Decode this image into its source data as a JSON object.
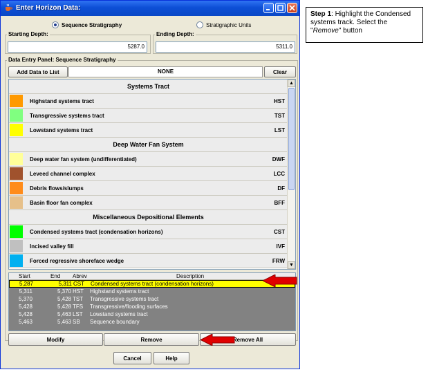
{
  "window": {
    "title": "Enter Horizon Data:"
  },
  "mode": {
    "options": [
      {
        "label": "Sequence Stratigraphy",
        "selected": true
      },
      {
        "label": "Stratigraphic Units",
        "selected": false
      }
    ]
  },
  "depth": {
    "starting_label": "Starting Depth:",
    "starting_value": "5287.0",
    "ending_label": "Ending Depth:",
    "ending_value": "5311.0"
  },
  "panel": {
    "title": "Data Entry Panel: Sequence Stratigraphy",
    "add_label": "Add Data to List",
    "current_value": "NONE",
    "clear_label": "Clear"
  },
  "categories": {
    "systems_tract": "Systems Tract",
    "deep_water": "Deep Water Fan System",
    "misc": "Miscellaneous Depositional Elements"
  },
  "items": [
    {
      "name": "Highstand systems tract",
      "abbr": "HST",
      "color": "#ff9900"
    },
    {
      "name": "Transgressive systems tract",
      "abbr": "TST",
      "color": "#80ff80"
    },
    {
      "name": "Lowstand systems tract",
      "abbr": "LST",
      "color": "#ffff00"
    },
    {
      "name": "Deep water fan system (undifferentiated)",
      "abbr": "DWF",
      "color": "#ffff99"
    },
    {
      "name": "Leveed channel complex",
      "abbr": "LCC",
      "color": "#a0522d"
    },
    {
      "name": "Debris flows/slumps",
      "abbr": "DF",
      "color": "#ff8c1a"
    },
    {
      "name": "Basin floor fan complex",
      "abbr": "BFF",
      "color": "#e6c08a"
    },
    {
      "name": "Condensed systems tract (condensation horizons)",
      "abbr": "CST",
      "color": "#00ff00"
    },
    {
      "name": "Incised valley fill",
      "abbr": "IVF",
      "color": "#c0c0c0"
    },
    {
      "name": "Forced regressive shoreface wedge",
      "abbr": "FRW",
      "color": "#00b0f0"
    }
  ],
  "table": {
    "headers": {
      "start": "Start",
      "end": "End",
      "abrev": "Abrev",
      "description": "Description"
    },
    "rows": [
      {
        "start": "5,287",
        "end": "5,311",
        "abrev": "CST",
        "description": "Condensed systems tract (condensation horizons)",
        "selected": true
      },
      {
        "start": "5,311",
        "end": "5,370",
        "abrev": "HST",
        "description": "Highstand systems tract"
      },
      {
        "start": "5,370",
        "end": "5,428",
        "abrev": "TST",
        "description": "Transgressive systems tract"
      },
      {
        "start": "5,428",
        "end": "5,428",
        "abrev": "TFS",
        "description": "Transgressive/flooding surfaces"
      },
      {
        "start": "5,428",
        "end": "5,463",
        "abrev": "LST",
        "description": "Lowstand systems tract"
      },
      {
        "start": "5,463",
        "end": "5,463",
        "abrev": "SB",
        "description": "Sequence boundary"
      }
    ]
  },
  "actions": {
    "modify": "Modify",
    "remove": "Remove",
    "remove_all": "Remove All"
  },
  "dialog": {
    "cancel": "Cancel",
    "help": "Help"
  },
  "callout": {
    "step": "Step 1",
    "text1": ": Highlight the Condensed systems track. Select the \"",
    "emph": "Remove",
    "text2": "\" button"
  },
  "colors": {
    "titlebar": "#0d4fd6",
    "selection": "#ffff00",
    "arrow": "#e00000"
  }
}
